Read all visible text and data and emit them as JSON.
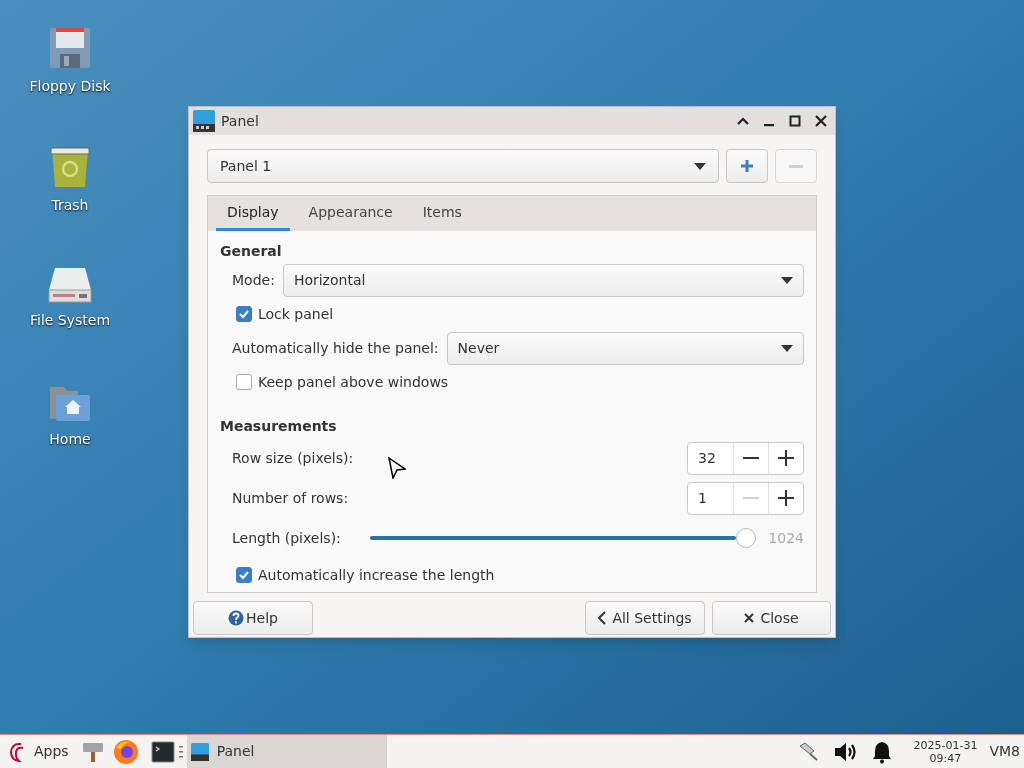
{
  "desktop_icons": [
    {
      "label": "Floppy Disk",
      "kind": "floppy"
    },
    {
      "label": "Trash",
      "kind": "trash"
    },
    {
      "label": "File System",
      "kind": "drive"
    },
    {
      "label": "Home",
      "kind": "home"
    }
  ],
  "window": {
    "title": "Panel",
    "panel_select": {
      "value": "Panel 1"
    },
    "remove_panel": {
      "disabled": true
    },
    "tabs": [
      {
        "label": "Display",
        "selected": true
      },
      {
        "label": "Appearance",
        "selected": false
      },
      {
        "label": "Items",
        "selected": false
      }
    ],
    "sections": [
      {
        "heading": "General",
        "rows": [
          {
            "kind": "dropdown",
            "label": "Mode:",
            "value": "Horizontal"
          },
          {
            "kind": "checkbox",
            "label": "Lock panel",
            "checked": true
          },
          {
            "kind": "dropdown",
            "label": "Automatically hide the panel:",
            "value": "Never"
          },
          {
            "kind": "checkbox",
            "label": "Keep panel above windows",
            "checked": false
          }
        ]
      },
      {
        "heading": "Measurements",
        "rows": [
          {
            "kind": "spin",
            "label": "Row size (pixels):",
            "value": "32",
            "minus_disabled": false
          },
          {
            "kind": "spin",
            "label": "Number of rows:",
            "value": "1",
            "minus_disabled": true
          },
          {
            "kind": "slider",
            "label": "Length (pixels):",
            "level": 1,
            "reading": "1024"
          },
          {
            "kind": "checkbox",
            "label": "Automatically increase the length",
            "checked": true
          }
        ]
      }
    ],
    "buttons": {
      "help": "Help",
      "all_settings": "All Settings",
      "close": "Close"
    }
  },
  "taskbar": {
    "apps": "Apps",
    "window_button": {
      "label": "Panel",
      "selected": true
    },
    "date": "2025-01-31",
    "time": "09:47",
    "workspace": "VM8"
  }
}
